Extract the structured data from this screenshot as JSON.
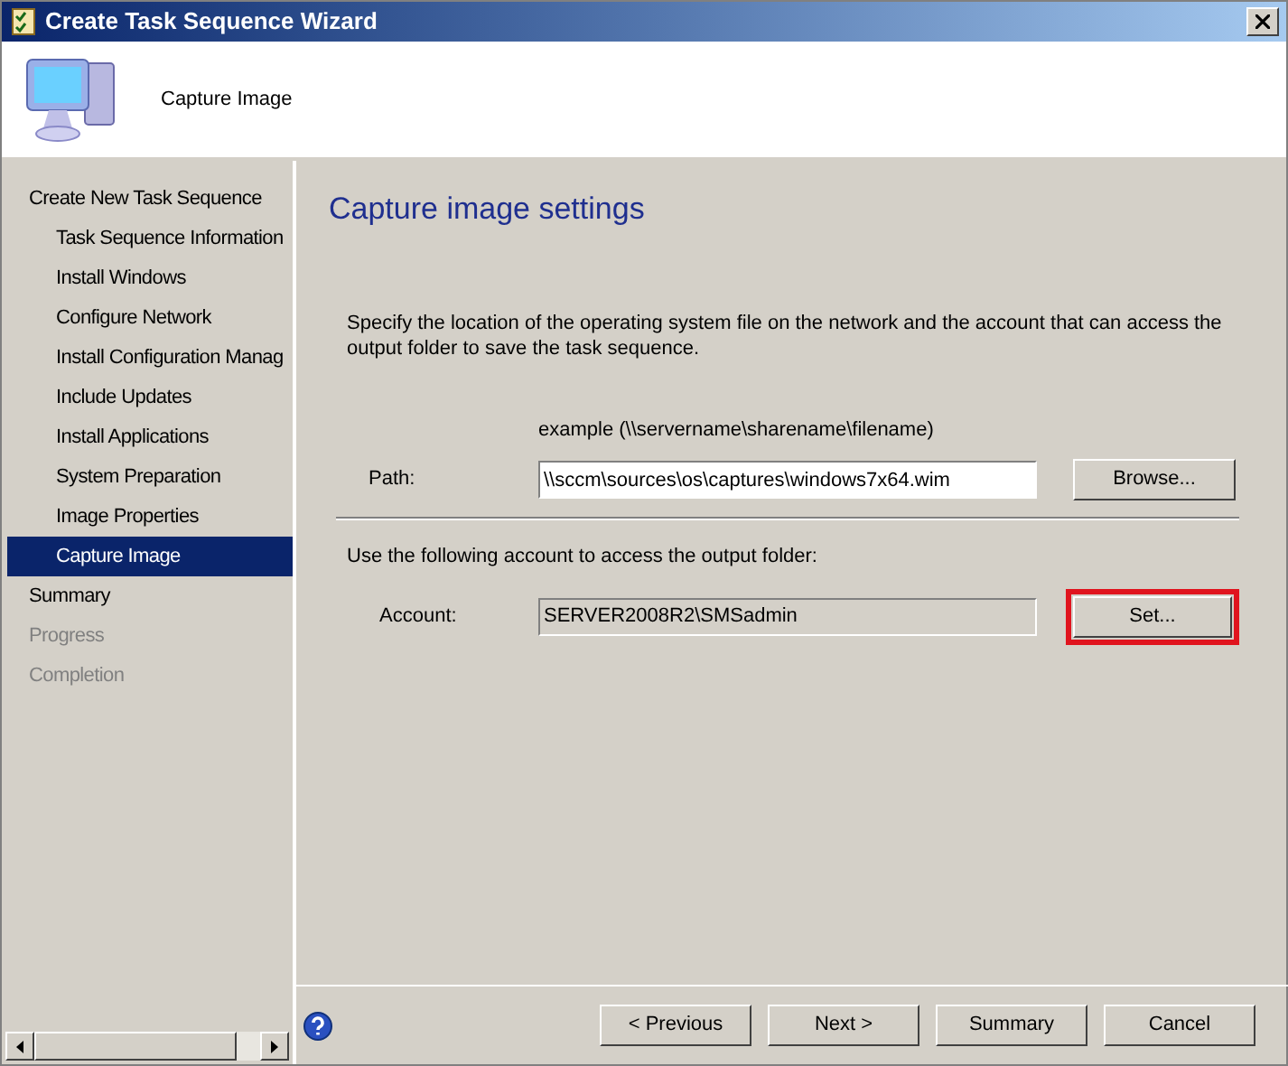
{
  "window": {
    "title": "Create Task Sequence Wizard"
  },
  "header": {
    "title": "Capture Image"
  },
  "sidebar": {
    "items": [
      {
        "label": "Create New Task Sequence",
        "selected": false,
        "disabled": false,
        "children": [
          {
            "label": "Task Sequence Information",
            "selected": false,
            "disabled": false
          },
          {
            "label": "Install Windows",
            "selected": false,
            "disabled": false
          },
          {
            "label": "Configure Network",
            "selected": false,
            "disabled": false
          },
          {
            "label": "Install Configuration Manag",
            "selected": false,
            "disabled": false
          },
          {
            "label": "Include Updates",
            "selected": false,
            "disabled": false
          },
          {
            "label": "Install Applications",
            "selected": false,
            "disabled": false
          },
          {
            "label": "System Preparation",
            "selected": false,
            "disabled": false
          },
          {
            "label": "Image Properties",
            "selected": false,
            "disabled": false
          },
          {
            "label": "Capture Image",
            "selected": true,
            "disabled": false
          }
        ]
      },
      {
        "label": "Summary",
        "selected": false,
        "disabled": false
      },
      {
        "label": "Progress",
        "selected": false,
        "disabled": true
      },
      {
        "label": "Completion",
        "selected": false,
        "disabled": true
      }
    ]
  },
  "page": {
    "heading": "Capture image settings",
    "description": "Specify the location of the operating system file on the network and the account that can access the output folder to save the task sequence.",
    "example": "example (\\\\servername\\sharename\\filename)",
    "path": {
      "label": "Path:",
      "value": "\\\\sccm\\sources\\os\\captures\\windows7x64.wim",
      "button": "Browse..."
    },
    "account_note": "Use the following account to access the output folder:",
    "account": {
      "label": "Account:",
      "value": "SERVER2008R2\\SMSadmin",
      "button": "Set...",
      "highlighted": true
    }
  },
  "buttons": [
    "< Previous",
    "Next >",
    "Summary",
    "Cancel"
  ]
}
